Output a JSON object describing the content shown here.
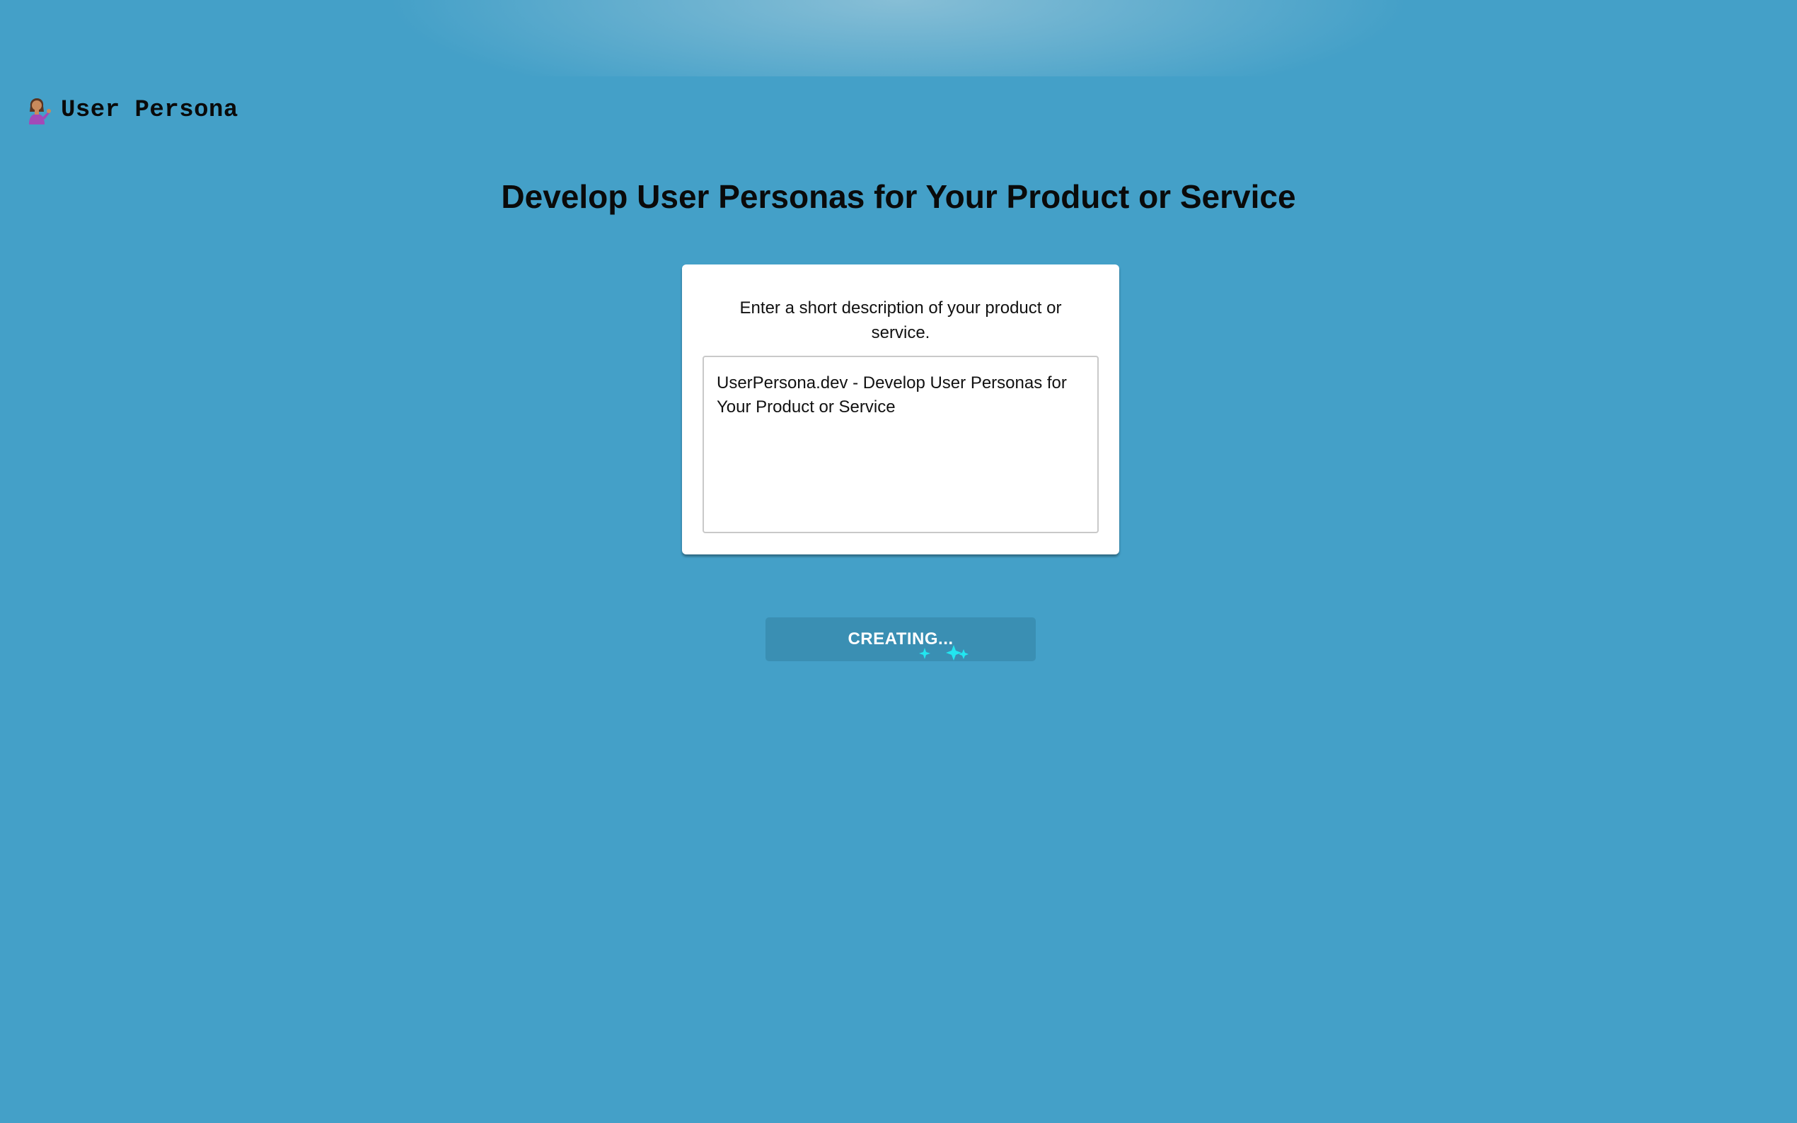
{
  "brand": {
    "label": "User Persona",
    "icon": "person-tipping-hand-icon"
  },
  "page": {
    "title": "Develop User Personas for Your Product or Service"
  },
  "form": {
    "prompt": "Enter a short description of your product or service.",
    "description_value": "UserPersona.dev - Develop User Personas for Your Product or Service",
    "submit_label": "CREATING...",
    "sparkle_icon": "sparkle-icon"
  },
  "colors": {
    "background": "#44a0c8",
    "button": "#3a8fb3",
    "sparkle": "#22e6f0"
  }
}
